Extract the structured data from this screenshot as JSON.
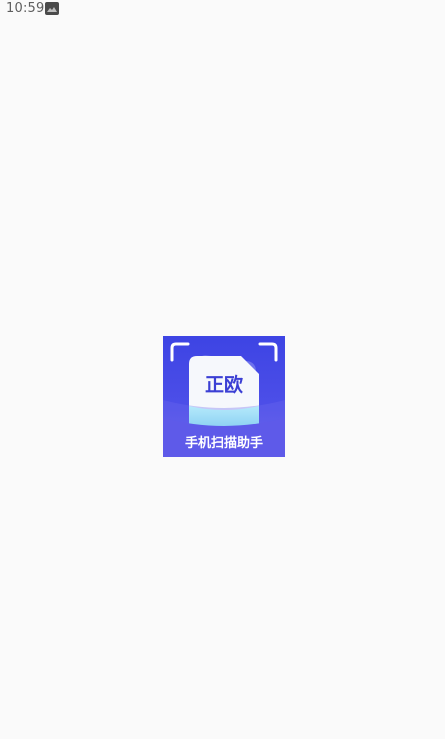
{
  "status_bar": {
    "time": "10:59",
    "notification_icon": "app-notification-icon"
  },
  "splash": {
    "logo_icon": "scanner-logo",
    "logo_title": "正欧",
    "logo_subtitle": "手机扫描助手",
    "colors": {
      "logo_top": "#3f43e6",
      "logo_bottom": "#6760ea",
      "card": "#f6f8fc",
      "card_text": "#3b3fd4",
      "scan_band": "#a9e4f9",
      "background": "#fafafa"
    }
  }
}
